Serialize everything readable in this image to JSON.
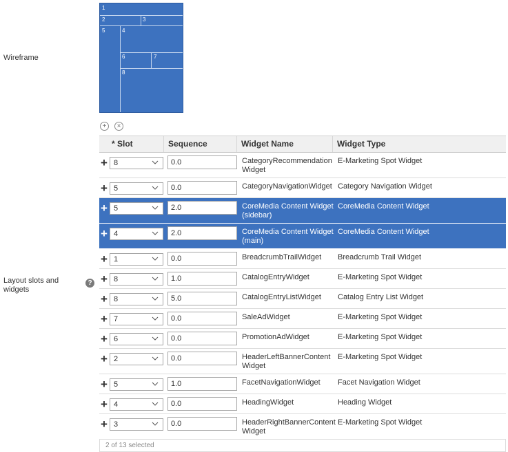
{
  "labels": {
    "wireframe": "Wireframe",
    "layout_slots_line1": "Layout slots and",
    "layout_slots_line2": "widgets",
    "help": "?"
  },
  "wireframe_slots": [
    "1",
    "2",
    "3",
    "5",
    "4",
    "6",
    "7",
    "8"
  ],
  "controls": {
    "add_icon": "plus-circle-icon",
    "remove_icon": "x-circle-icon"
  },
  "table": {
    "columns": [
      "* Slot",
      "Sequence",
      "Widget Name",
      "Widget Type"
    ],
    "rows": [
      {
        "slot": "8",
        "sequence": "0.0",
        "name": "CategoryRecommendation Widget",
        "type": "E-Marketing Spot Widget",
        "selected": false
      },
      {
        "slot": "5",
        "sequence": "0.0",
        "name": "CategoryNavigationWidget",
        "type": "Category Navigation Widget",
        "selected": false
      },
      {
        "slot": "5",
        "sequence": "2.0",
        "name": "CoreMedia Content Widget (sidebar)",
        "type": "CoreMedia Content Widget",
        "selected": true
      },
      {
        "slot": "4",
        "sequence": "2.0",
        "name": "CoreMedia Content Widget (main)",
        "type": "CoreMedia Content Widget",
        "selected": true
      },
      {
        "slot": "1",
        "sequence": "0.0",
        "name": "BreadcrumbTrailWidget",
        "type": "Breadcrumb Trail Widget",
        "selected": false
      },
      {
        "slot": "8",
        "sequence": "1.0",
        "name": "CatalogEntryWidget",
        "type": "E-Marketing Spot Widget",
        "selected": false
      },
      {
        "slot": "8",
        "sequence": "5.0",
        "name": "CatalogEntryListWidget",
        "type": "Catalog Entry List Widget",
        "selected": false
      },
      {
        "slot": "7",
        "sequence": "0.0",
        "name": "SaleAdWidget",
        "type": "E-Marketing Spot Widget",
        "selected": false
      },
      {
        "slot": "6",
        "sequence": "0.0",
        "name": "PromotionAdWidget",
        "type": "E-Marketing Spot Widget",
        "selected": false
      },
      {
        "slot": "2",
        "sequence": "0.0",
        "name": "HeaderLeftBannerContentWidget",
        "type": "E-Marketing Spot Widget",
        "selected": false
      },
      {
        "slot": "5",
        "sequence": "1.0",
        "name": "FacetNavigationWidget",
        "type": "Facet Navigation Widget",
        "selected": false
      },
      {
        "slot": "4",
        "sequence": "0.0",
        "name": "HeadingWidget",
        "type": "Heading Widget",
        "selected": false
      },
      {
        "slot": "3",
        "sequence": "0.0",
        "name": "HeaderRightBannerContent Widget",
        "type": "E-Marketing Spot Widget",
        "selected": false
      }
    ],
    "footer": "2 of 13 selected"
  },
  "colors": {
    "selected_row": "#3d72bf",
    "wireframe_fill": "#3d72bf"
  }
}
